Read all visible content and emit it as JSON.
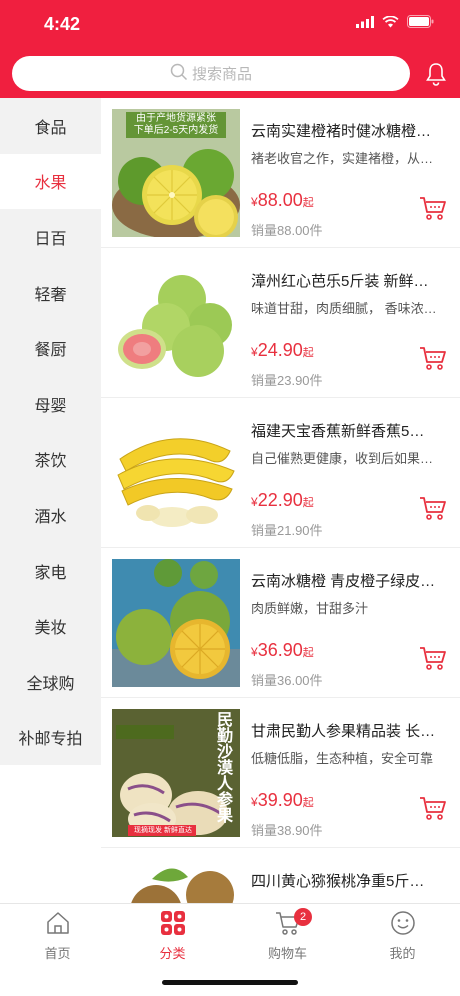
{
  "status_bar": {
    "time": "4:42"
  },
  "search": {
    "placeholder": "搜索商品"
  },
  "categories": [
    {
      "label": "食品"
    },
    {
      "label": "水果"
    },
    {
      "label": "日百"
    },
    {
      "label": "轻奢"
    },
    {
      "label": "餐厨"
    },
    {
      "label": "母婴"
    },
    {
      "label": "茶饮"
    },
    {
      "label": "酒水"
    },
    {
      "label": "家电"
    },
    {
      "label": "美妆"
    },
    {
      "label": "全球购"
    },
    {
      "label": "补邮专拍"
    }
  ],
  "active_category": "水果",
  "products": [
    {
      "name": "云南实建橙褚时健冰糖橙…",
      "desc": "褚老收官之作，实建褚橙，从…",
      "currency": "¥",
      "price": "88.00",
      "price_suffix": "起",
      "sales": "销量88.00件",
      "banner_line1": "由于产地货源紧张",
      "banner_line2": "下单后2-5天内发货"
    },
    {
      "name": "漳州红心芭乐5斤装 新鲜…",
      "desc": "味道甘甜，肉质细腻， 香味浓…",
      "currency": "¥",
      "price": "24.90",
      "price_suffix": "起",
      "sales": "销量23.90件"
    },
    {
      "name": "福建天宝香蕉新鲜香蕉5…",
      "desc": "自己催熟更健康，收到后如果…",
      "currency": "¥",
      "price": "22.90",
      "price_suffix": "起",
      "sales": "销量21.90件"
    },
    {
      "name": "云南冰糖橙 青皮橙子绿皮…",
      "desc": "肉质鲜嫩，甘甜多汁",
      "currency": "¥",
      "price": "36.90",
      "price_suffix": "起",
      "sales": "销量36.00件"
    },
    {
      "name": "甘肃民勤人参果精品装 长…",
      "desc": "低糖低脂，生态种植，安全可靠",
      "currency": "¥",
      "price": "39.90",
      "price_suffix": "起",
      "sales": "销量38.90件",
      "image_text": "民勤沙漠人参果",
      "image_tag": "现摘现发 新鲜直达"
    },
    {
      "name": "四川黄心猕猴桃净重5斤…",
      "desc": "",
      "currency": "¥",
      "price": "",
      "price_suffix": "",
      "sales": ""
    }
  ],
  "tabbar": {
    "items": [
      {
        "label": "首页",
        "icon": "home-icon"
      },
      {
        "label": "分类",
        "icon": "category-icon"
      },
      {
        "label": "购物车",
        "icon": "cart-icon"
      },
      {
        "label": "我的",
        "icon": "smile-icon"
      }
    ],
    "cart_badge": "2"
  },
  "colors": {
    "brand_red": "#f01f3f",
    "price_red": "#e8303f",
    "sidebar_bg": "#f2f2f2"
  }
}
